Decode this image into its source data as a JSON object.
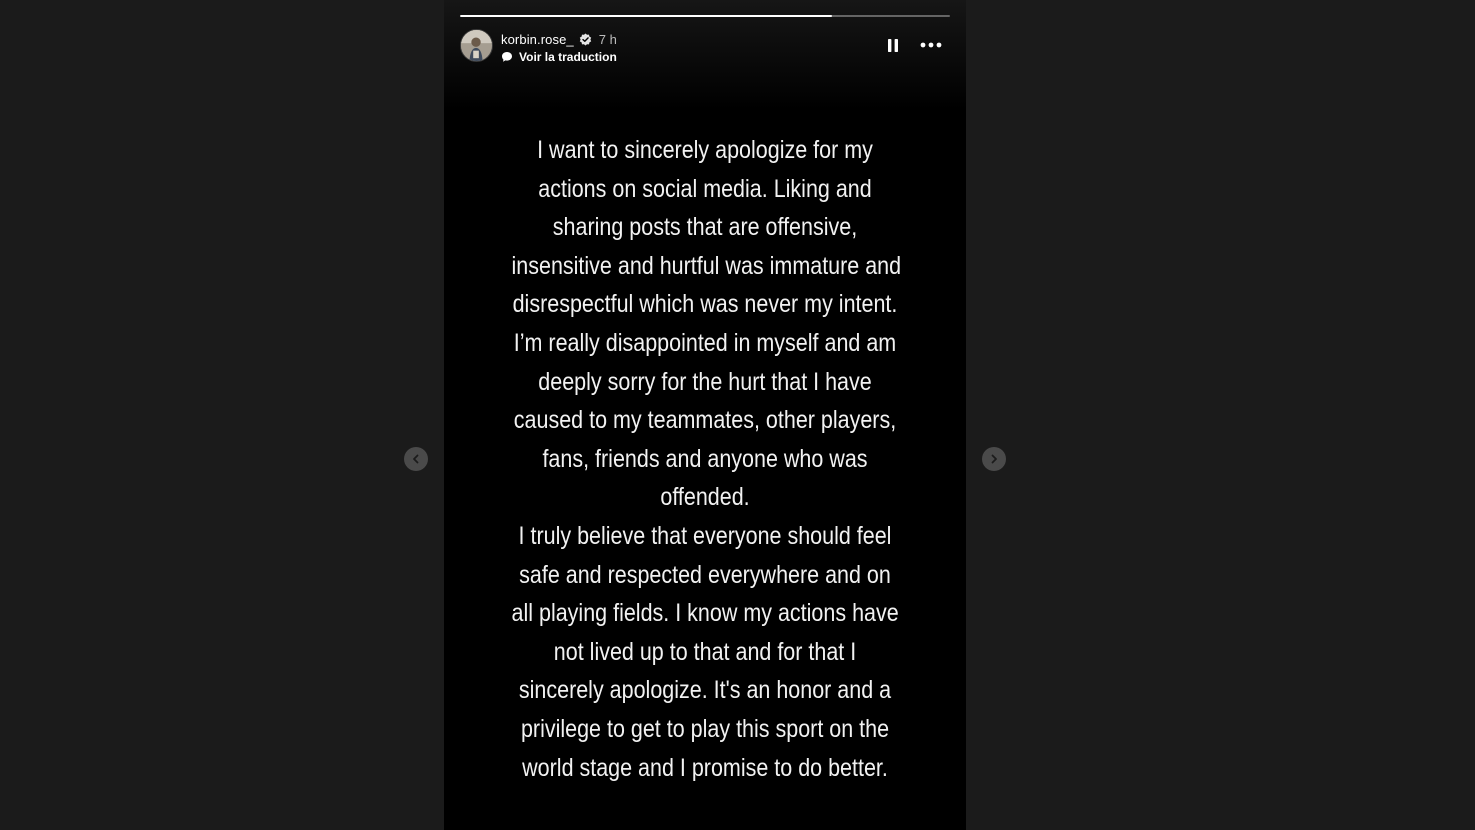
{
  "story": {
    "progress_fraction": 0.76,
    "user": {
      "username": "korbin.rose_",
      "verified": true,
      "timestamp": "7 h"
    },
    "translate_label": "Voir la traduction",
    "controls": {
      "pause_icon": "pause-icon",
      "more_icon": "more-horizontal-icon"
    },
    "text_lines": [
      "I want to sincerely apologize for my",
      "actions on social media. Liking and",
      "sharing posts that are offensive,",
      "insensitive and hurtful was immature and",
      "disrespectful which was never my intent.",
      "I’m really disappointed in myself and am",
      "deeply sorry for the hurt that I have",
      "caused to my teammates, other players,",
      "fans, friends and anyone who was",
      "offended.",
      "I truly believe that everyone should feel",
      "safe and respected everywhere and on",
      "all playing fields. I know my actions have",
      "not lived up to that and for that I",
      "sincerely apologize. It's an honor and a",
      "privilege to get to play this sport on the",
      "world stage and I promise to do better."
    ]
  },
  "navigation": {
    "prev_icon": "chevron-left-icon",
    "next_icon": "chevron-right-icon"
  },
  "colors": {
    "page_background": "#1b1b1b",
    "story_background": "#000000",
    "text": "#f2f2f2",
    "nav_button": "#4a4a4a"
  }
}
